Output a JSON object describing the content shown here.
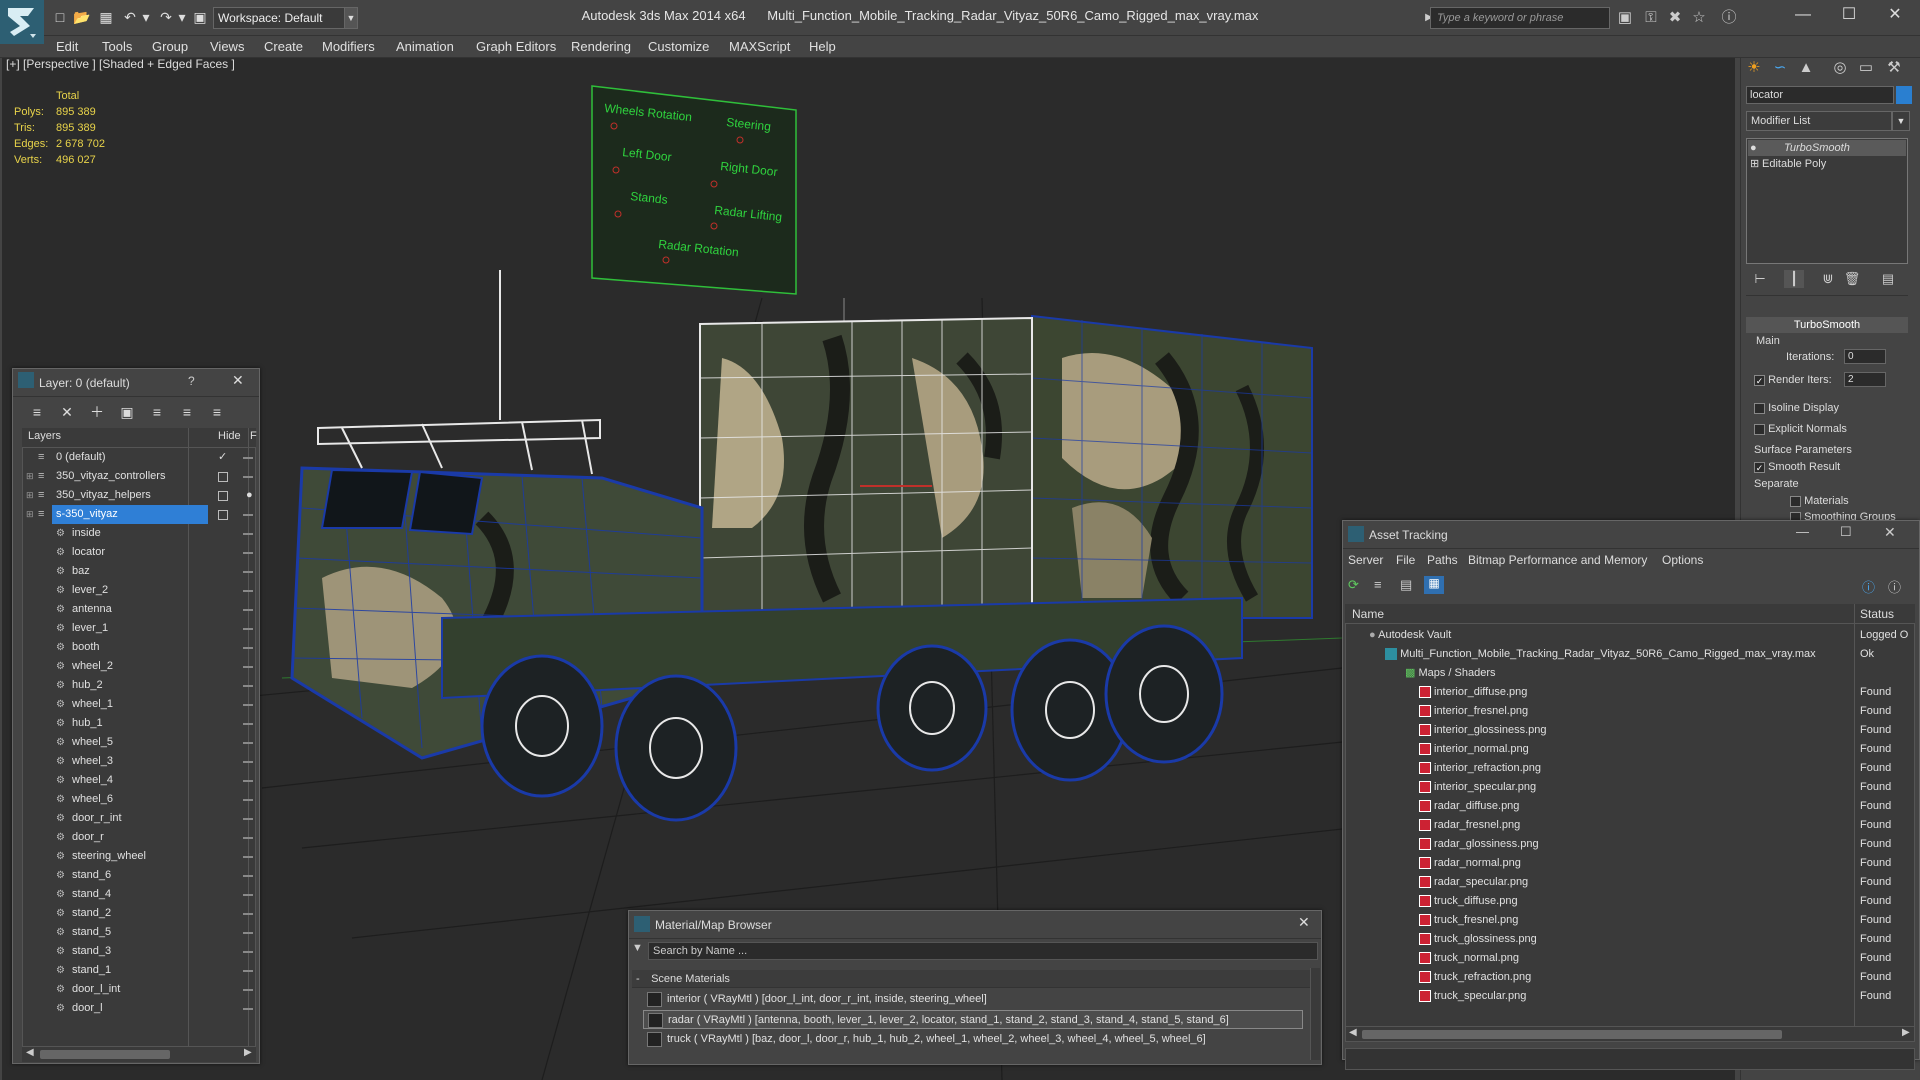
{
  "app": {
    "title_left": "Autodesk 3ds Max  2014 x64",
    "file_title": "Multi_Function_Mobile_Tracking_Radar_Vityaz_50R6_Camo_Rigged_max_vray.max",
    "workspace": "Workspace: Default",
    "search_placeholder": "Type a keyword or phrase"
  },
  "menu": [
    "Edit",
    "Tools",
    "Group",
    "Views",
    "Create",
    "Modifiers",
    "Animation",
    "Graph Editors",
    "Rendering",
    "Customize",
    "MAXScript",
    "Help"
  ],
  "viewport": {
    "label": "[+] [Perspective ] [Shaded + Edged Faces ]",
    "stats": {
      "header": "Total",
      "rows": [
        {
          "label": "Polys:",
          "value": "895 389"
        },
        {
          "label": "Tris:",
          "value": "895 389"
        },
        {
          "label": "Edges:",
          "value": "2 678 702"
        },
        {
          "label": "Verts:",
          "value": "496 027"
        }
      ]
    },
    "controls_board": [
      "Wheels Rotation",
      "Steering",
      "Left Door",
      "Right Door",
      "Stands",
      "Radar Lifting",
      "Radar Rotation"
    ],
    "colors": {
      "wire_blue": "#1a3aa8",
      "wire_white": "#e8e8e8",
      "controller_green": "#1fa52b"
    }
  },
  "command_panel": {
    "object_name": "locator",
    "modifier_list": "Modifier List",
    "stack": [
      "TurboSmooth",
      "Editable Poly"
    ],
    "rollout": "TurboSmooth",
    "main": "Main",
    "iterations_label": "Iterations:",
    "iterations": "0",
    "render_iters_label": "Render Iters:",
    "render_iters": "2",
    "isoline": "Isoline Display",
    "explicit": "Explicit Normals",
    "surface": "Surface Parameters",
    "smooth": "Smooth Result",
    "separate": "Separate",
    "materials": "Materials",
    "smoothing": "Smoothing Groups"
  },
  "layer_panel": {
    "title": "Layer: 0 (default)",
    "help": "?",
    "col_layers": "Layers",
    "col_hide": "Hide",
    "col_f": "F",
    "layers": [
      {
        "name": "0 (default)",
        "level": 0
      },
      {
        "name": "350_vityaz_controllers",
        "level": 0
      },
      {
        "name": "350_vityaz_helpers",
        "level": 0
      },
      {
        "name": "s-350_vityaz",
        "level": 0,
        "selected": true
      }
    ],
    "objects": [
      "inside",
      "locator",
      "baz",
      "lever_2",
      "antenna",
      "lever_1",
      "booth",
      "wheel_2",
      "hub_2",
      "wheel_1",
      "hub_1",
      "wheel_5",
      "wheel_3",
      "wheel_4",
      "wheel_6",
      "door_r_int",
      "door_r",
      "steering_wheel",
      "stand_6",
      "stand_4",
      "stand_2",
      "stand_5",
      "stand_3",
      "stand_1",
      "door_l_int",
      "door_l"
    ]
  },
  "asset_tracking": {
    "title": "Asset Tracking",
    "menu": [
      "Server",
      "File",
      "Paths",
      "Bitmap Performance and Memory",
      "Options"
    ],
    "col_name": "Name",
    "col_status": "Status",
    "vault": {
      "name": "Autodesk Vault",
      "status": "Logged O"
    },
    "file": {
      "name": "Multi_Function_Mobile_Tracking_Radar_Vityaz_50R6_Camo_Rigged_max_vray.max",
      "status": "Ok"
    },
    "maps_group": "Maps / Shaders",
    "maps": [
      {
        "name": "interior_diffuse.png",
        "status": "Found"
      },
      {
        "name": "interior_fresnel.png",
        "status": "Found"
      },
      {
        "name": "interior_glossiness.png",
        "status": "Found"
      },
      {
        "name": "interior_normal.png",
        "status": "Found"
      },
      {
        "name": "interior_refraction.png",
        "status": "Found"
      },
      {
        "name": "interior_specular.png",
        "status": "Found"
      },
      {
        "name": "radar_diffuse.png",
        "status": "Found"
      },
      {
        "name": "radar_fresnel.png",
        "status": "Found"
      },
      {
        "name": "radar_glossiness.png",
        "status": "Found"
      },
      {
        "name": "radar_normal.png",
        "status": "Found"
      },
      {
        "name": "radar_specular.png",
        "status": "Found"
      },
      {
        "name": "truck_diffuse.png",
        "status": "Found"
      },
      {
        "name": "truck_fresnel.png",
        "status": "Found"
      },
      {
        "name": "truck_glossiness.png",
        "status": "Found"
      },
      {
        "name": "truck_normal.png",
        "status": "Found"
      },
      {
        "name": "truck_refraction.png",
        "status": "Found"
      },
      {
        "name": "truck_specular.png",
        "status": "Found"
      }
    ]
  },
  "material_browser": {
    "title": "Material/Map Browser",
    "search_placeholder": "Search by Name ...",
    "group": "Scene Materials",
    "materials": [
      "interior  ( VRayMtl )  [door_l_int, door_r_int, inside, steering_wheel]",
      "radar  ( VRayMtl )  [antenna, booth, lever_1, lever_2, locator, stand_1, stand_2, stand_3, stand_4, stand_5, stand_6]",
      "truck  ( VRayMtl )  [baz, door_l,  door_r, hub_1, hub_2, wheel_1, wheel_2, wheel_3, wheel_4, wheel_5, wheel_6]"
    ]
  }
}
